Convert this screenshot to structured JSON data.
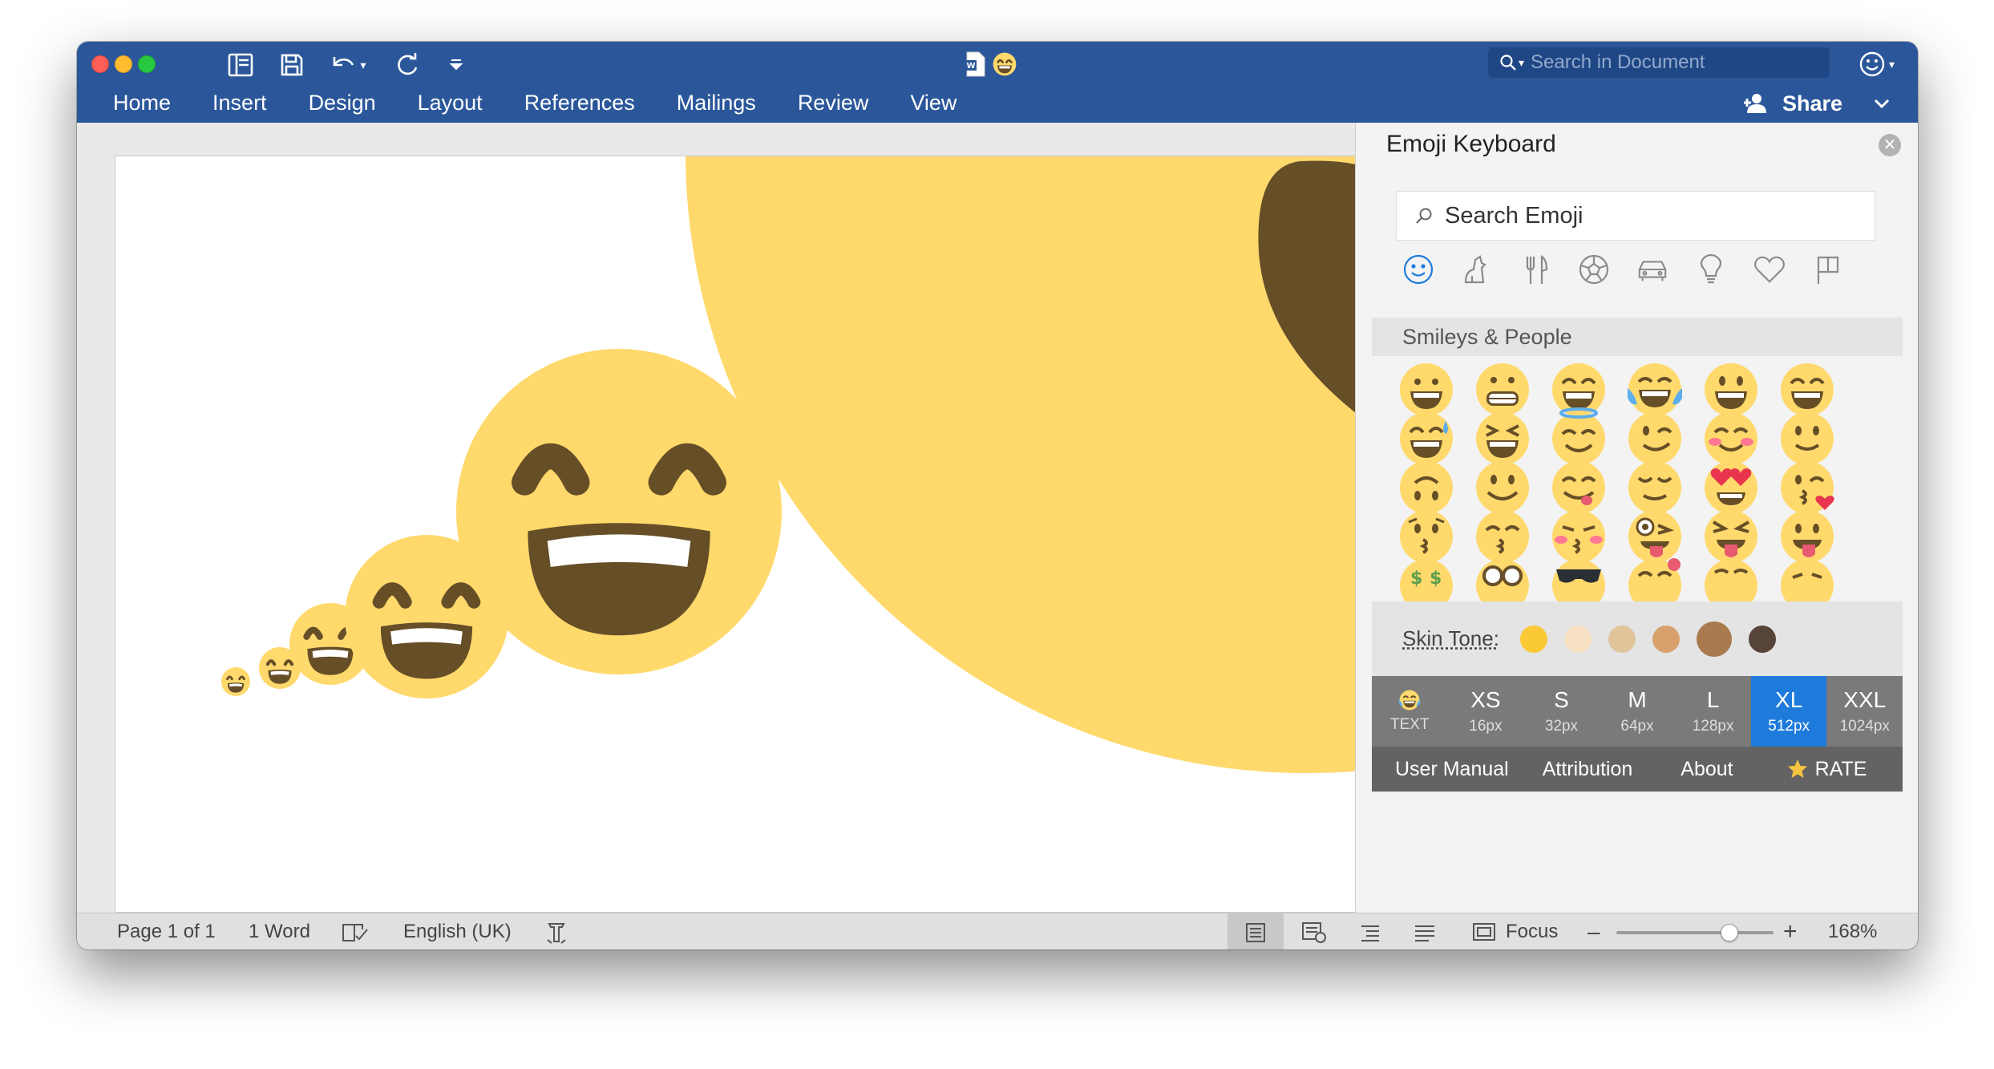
{
  "window": {
    "document_title_icon": "word-doc-icon",
    "search_placeholder": "Search in Document"
  },
  "ribbon": {
    "tabs": [
      "Home",
      "Insert",
      "Design",
      "Layout",
      "References",
      "Mailings",
      "Review",
      "View"
    ],
    "share_label": "Share"
  },
  "panel": {
    "title": "Emoji Keyboard",
    "search_placeholder": "Search Emoji",
    "categories": [
      "smileys-icon",
      "animals-icon",
      "food-icon",
      "activity-icon",
      "travel-icon",
      "objects-icon",
      "symbols-icon",
      "flags-icon"
    ],
    "active_category": "smileys-icon",
    "section_label": "Smileys & People",
    "skin_tone_label": "Skin Tone:",
    "skin_tones": [
      "#fbc935",
      "#f7dfc2",
      "#e0c49a",
      "#d8a06d",
      "#a97a4e",
      "#574438"
    ],
    "selected_skin_tone": 4,
    "sizes": [
      {
        "label": "TEXT",
        "px": ""
      },
      {
        "label": "XS",
        "px": "16px"
      },
      {
        "label": "S",
        "px": "32px"
      },
      {
        "label": "M",
        "px": "64px"
      },
      {
        "label": "L",
        "px": "128px"
      },
      {
        "label": "XL",
        "px": "512px"
      },
      {
        "label": "XXL",
        "px": "1024px"
      }
    ],
    "selected_size": "XL",
    "footer": {
      "manual": "User Manual",
      "attribution": "Attribution",
      "about": "About",
      "rate": "RATE"
    }
  },
  "status": {
    "page": "Page 1 of 1",
    "words": "1 Word",
    "language": "English (UK)",
    "focus": "Focus",
    "zoom": "168%",
    "zoom_fraction": 0.72
  },
  "colors": {
    "accent": "#1e7bdc",
    "title_bar": "#2b579a",
    "emoji_face": "#ffd96c",
    "emoji_feature": "#664e27"
  }
}
